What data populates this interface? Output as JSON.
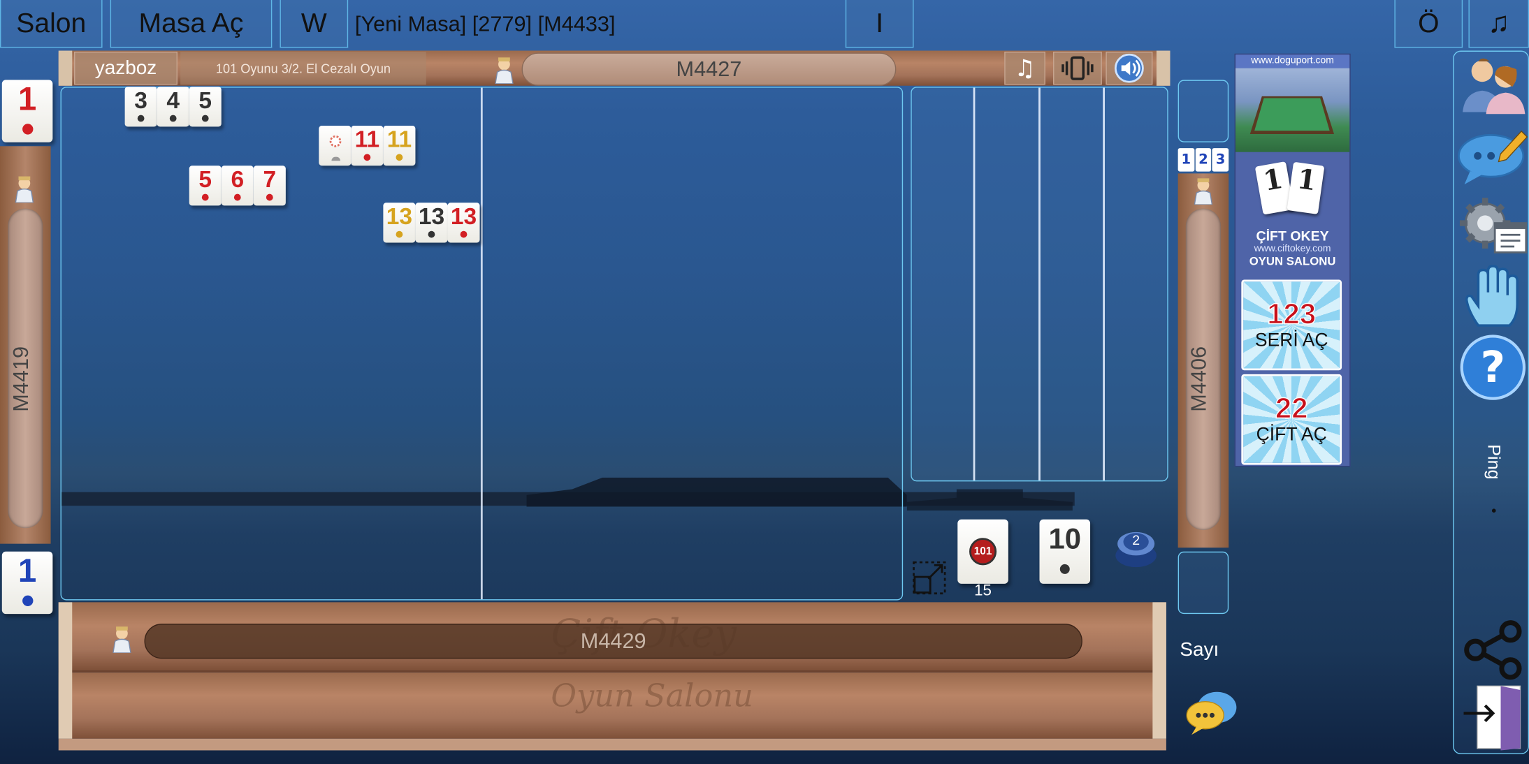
{
  "top": {
    "salon": "Salon",
    "masa_ac": "Masa Aç",
    "w": "W",
    "info": "[Yeni Masa] [2779] [M4433]",
    "i": "I",
    "o": "Ö",
    "music": "♫"
  },
  "board": {
    "tab_name": "yazboz",
    "game_type": "101 Oyunu 3/2. El Cezalı Oyun",
    "top_player": "M4427",
    "left_player": "M4419",
    "right_player": "M4406",
    "bottom_player": "M4429",
    "controls": {
      "music": "♫",
      "vibrate": "vibrate-icon",
      "sound": "speaker-icon"
    }
  },
  "left_indicator": {
    "top_tile": "1",
    "top_color": "red",
    "bottom_tile": "1",
    "bottom_color": "blue"
  },
  "melds": [
    [
      {
        "n": "3",
        "c": "black"
      },
      {
        "n": "4",
        "c": "black"
      },
      {
        "n": "5",
        "c": "black"
      }
    ],
    [
      {
        "n": "joker",
        "c": "black"
      },
      {
        "n": "11",
        "c": "red"
      },
      {
        "n": "11",
        "c": "yellow"
      }
    ],
    [
      {
        "n": "5",
        "c": "red"
      },
      {
        "n": "6",
        "c": "red"
      },
      {
        "n": "7",
        "c": "red"
      }
    ],
    [
      {
        "n": "13",
        "c": "yellow"
      },
      {
        "n": "13",
        "c": "black"
      },
      {
        "n": "13",
        "c": "red"
      }
    ]
  ],
  "center": {
    "deck_label": "101",
    "deck_count": "15",
    "indicator": "10",
    "indicator_color": "black",
    "badge": "2"
  },
  "right_col": {
    "order_icons": [
      "1",
      "2",
      "3"
    ],
    "sayi": "Sayı"
  },
  "ads": {
    "url1": "www.doguport.com",
    "tile1": "1",
    "tile2": "1",
    "brand": "ÇİFT OKEY",
    "url2": "www.ciftokey.com",
    "salon": "OYUN SALONU",
    "btn1_num": "123",
    "btn1_text": "SERİ AÇ",
    "btn2_num": "22",
    "btn2_text": "ÇİFT AÇ"
  },
  "sidebar": {
    "ping": "Ping"
  },
  "watermark": {
    "line1": "Çift Okey",
    "line2": "Oyun Salonu"
  }
}
